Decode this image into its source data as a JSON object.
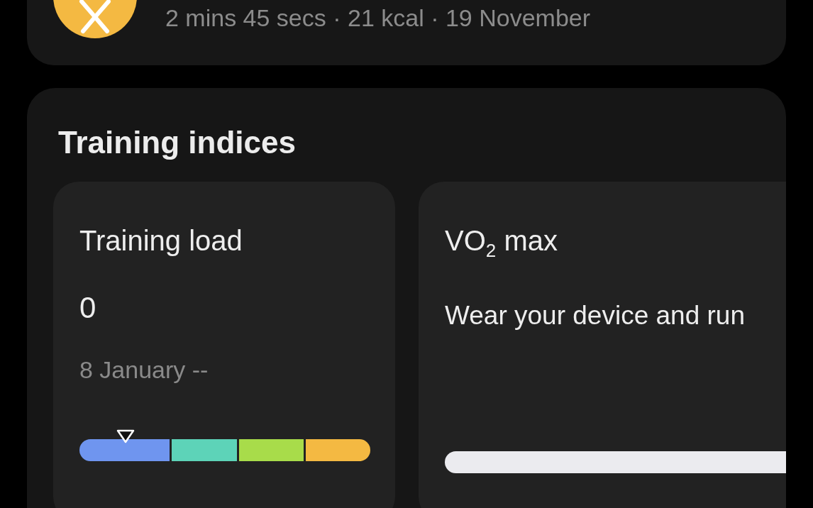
{
  "workout": {
    "summary": "2 mins 45 secs · 21 kcal · 19 November"
  },
  "training_indices": {
    "title": "Training indices",
    "cards": [
      {
        "kind": "load",
        "title": "Training load",
        "value": "0",
        "date": "8 January --",
        "segments": [
          {
            "color": "#6f95ef"
          },
          {
            "color": "#5dd3b8"
          },
          {
            "color": "#a8dc4a"
          },
          {
            "color": "#f4b942"
          }
        ]
      },
      {
        "kind": "vo2",
        "title": "VO$_{2}$ max",
        "message": "Wear your device and run"
      }
    ]
  }
}
